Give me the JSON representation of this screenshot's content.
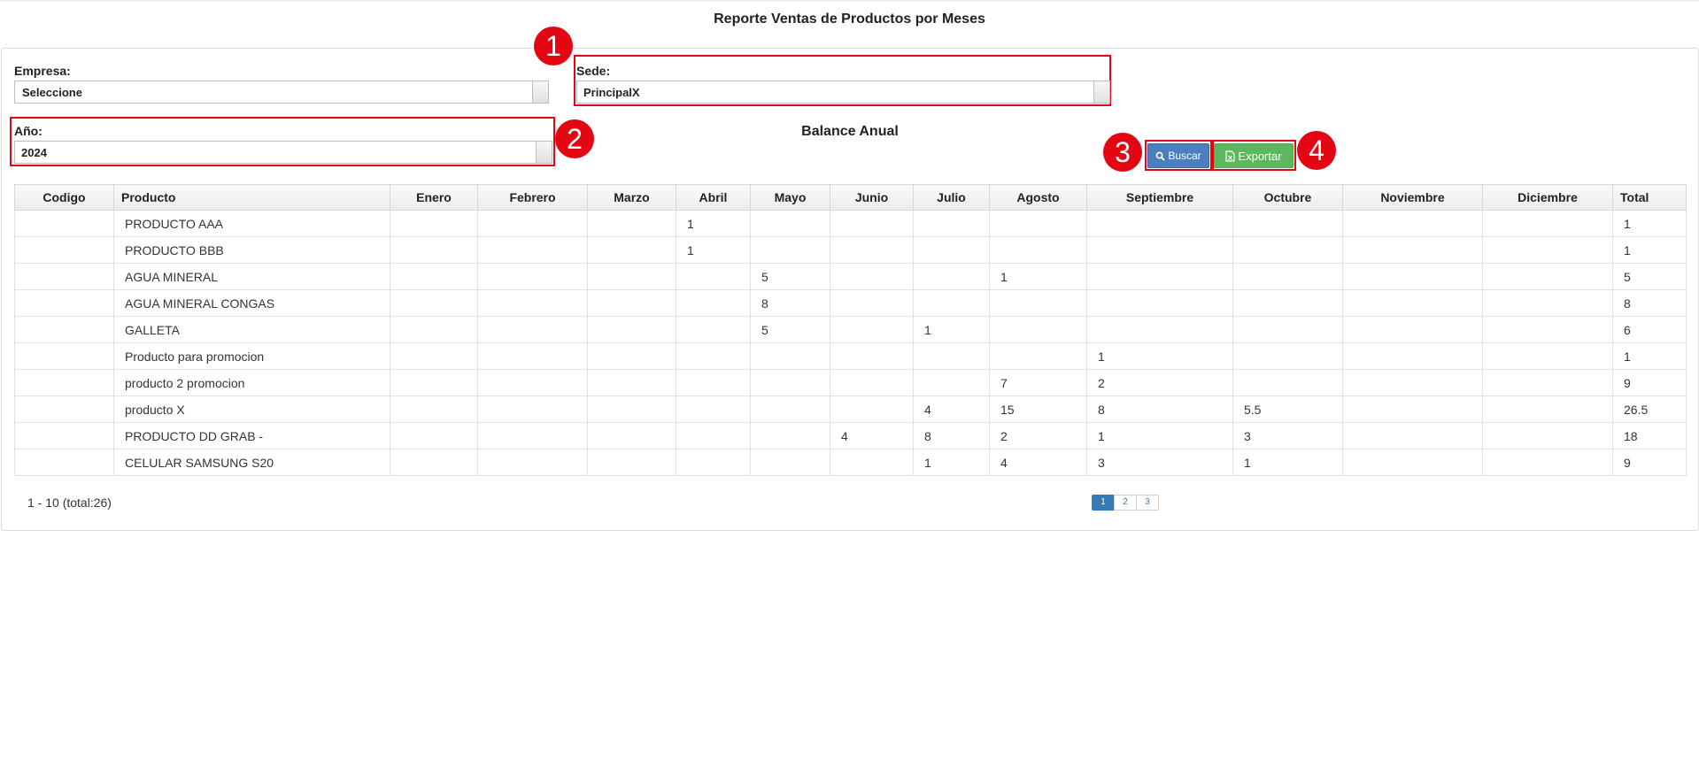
{
  "page_title": "Reporte Ventas de Productos por Meses",
  "filters": {
    "empresa_label": "Empresa:",
    "empresa_value": "Seleccione",
    "sede_label": "Sede:",
    "sede_value": "PrincipalX",
    "anio_label": "Año:",
    "anio_value": "2024"
  },
  "balance_title": "Balance Anual",
  "buttons": {
    "buscar": "Buscar",
    "exportar": "Exportar"
  },
  "annotations": [
    "1",
    "2",
    "3",
    "4"
  ],
  "colors": {
    "highlight": "#e30613",
    "buscar": "#4a7fc1",
    "exportar": "#5cb85c",
    "page_active": "#337ab7"
  },
  "icons": {
    "buscar": "search-icon",
    "exportar": "file-excel-icon"
  },
  "table": {
    "headers": [
      "Codigo",
      "Producto",
      "Enero",
      "Febrero",
      "Marzo",
      "Abril",
      "Mayo",
      "Junio",
      "Julio",
      "Agosto",
      "Septiembre",
      "Octubre",
      "Noviembre",
      "Diciembre",
      "Total"
    ],
    "rows": [
      [
        "",
        "PRODUCTO AAA",
        "",
        "",
        "",
        "1",
        "",
        "",
        "",
        "",
        "",
        "",
        "",
        "",
        "1"
      ],
      [
        "",
        "PRODUCTO BBB",
        "",
        "",
        "",
        "1",
        "",
        "",
        "",
        "",
        "",
        "",
        "",
        "",
        "1"
      ],
      [
        "",
        "AGUA MINERAL",
        "",
        "",
        "",
        "",
        "5",
        "",
        "",
        "1",
        "",
        "",
        "",
        "",
        "5"
      ],
      [
        "",
        "AGUA MINERAL CONGAS",
        "",
        "",
        "",
        "",
        "8",
        "",
        "",
        "",
        "",
        "",
        "",
        "",
        "8"
      ],
      [
        "",
        "GALLETA",
        "",
        "",
        "",
        "",
        "5",
        "",
        "1",
        "",
        "",
        "",
        "",
        "",
        "6"
      ],
      [
        "",
        "Producto para promocion",
        "",
        "",
        "",
        "",
        "",
        "",
        "",
        "",
        "1",
        "",
        "",
        "",
        "1"
      ],
      [
        "",
        "producto 2 promocion",
        "",
        "",
        "",
        "",
        "",
        "",
        "",
        "7",
        "2",
        "",
        "",
        "",
        "9"
      ],
      [
        "",
        "producto X",
        "",
        "",
        "",
        "",
        "",
        "",
        "4",
        "15",
        "8",
        "5.5",
        "",
        "",
        "26.5"
      ],
      [
        "",
        "PRODUCTO DD GRAB -",
        "",
        "",
        "",
        "",
        "",
        "4",
        "8",
        "2",
        "1",
        "3",
        "",
        "",
        "18"
      ],
      [
        "",
        "CELULAR SAMSUNG S20",
        "",
        "",
        "",
        "",
        "",
        "",
        "1",
        "4",
        "3",
        "1",
        "",
        "",
        "9"
      ]
    ]
  },
  "pagination": {
    "info": "1 - 10 (total:26)",
    "pages": [
      "1",
      "2",
      "3"
    ],
    "active": "1"
  }
}
